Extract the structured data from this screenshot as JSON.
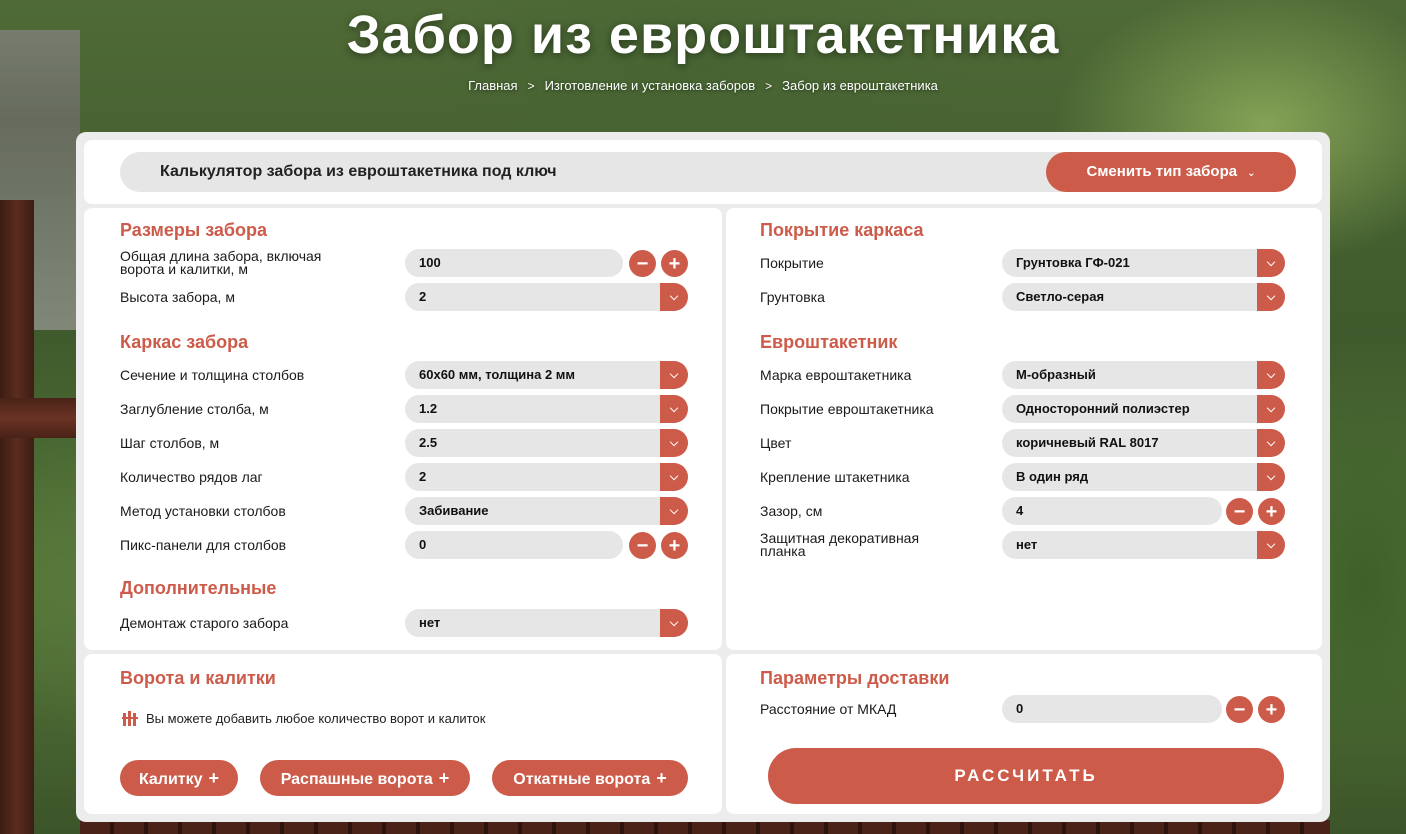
{
  "hero": {
    "title": "Забор из евроштакетника",
    "breadcrumb": [
      "Главная",
      "Изготовление и установка заборов",
      "Забор из евроштакетника"
    ],
    "breadcrumb_sep": ">"
  },
  "calculator": {
    "title": "Калькулятор забора из евроштакетника под ключ",
    "switch_label": "Сменить тип забора",
    "chevron": "⌄"
  },
  "sizes": {
    "title": "Размеры забора",
    "length_label": "Общая длина забора, включая ворота и калитки, м",
    "length_value": "100",
    "height_label": "Высота забора, м",
    "height_value": "2"
  },
  "frame": {
    "title": "Каркас забора",
    "section_label": "Сечение и толщина столбов",
    "section_value": "60x60 мм, толщина 2 мм",
    "depth_label": "Заглубление столба, м",
    "depth_value": "1.2",
    "step_label": "Шаг столбов, м",
    "step_value": "2.5",
    "rows_label": "Количество рядов лаг",
    "rows_value": "2",
    "method_label": "Метод установки столбов",
    "method_value": "Забивание",
    "pix_label": "Пикс-панели для столбов",
    "pix_value": "0"
  },
  "extra": {
    "title": "Дополнительные",
    "dismantle_label": "Демонтаж старого забора",
    "dismantle_value": "нет"
  },
  "coating": {
    "title": "Покрытие каркаса",
    "cover_label": "Покрытие",
    "cover_value": "Грунтовка ГФ-021",
    "primer_label": "Грунтовка",
    "primer_value": "Светло-серая"
  },
  "picket": {
    "title": "Евроштакетник",
    "brand_label": "Марка евроштакетника",
    "brand_value": "М-образный",
    "coat_label": "Покрытие евроштакетника",
    "coat_value": "Односторонний полиэстер",
    "color_label": "Цвет",
    "color_value": "коричневый RAL 8017",
    "mount_label": "Крепление штакетника",
    "mount_value": "В один ряд",
    "gap_label": "Зазор, см",
    "gap_value": "4",
    "strip_label": "Защитная декоративная планка",
    "strip_value": "нет"
  },
  "gates": {
    "title": "Ворота и калитки",
    "info": "Вы можете добавить любое количество ворот и калиток",
    "wicket_label": "Калитку",
    "swing_label": "Распашные ворота",
    "sliding_label": "Откатные ворота",
    "plus": "+"
  },
  "delivery": {
    "title": "Параметры доставки",
    "distance_label": "Расстояние от МКАД",
    "distance_value": "0",
    "calc_label": "РАССЧИТАТЬ"
  },
  "controls": {
    "minus": "−",
    "plus": "+"
  },
  "icons": {
    "select": "chevron-down-icon",
    "minus": "minus-icon",
    "plus": "plus-icon",
    "gates_info": "fence-icon"
  },
  "colors": {
    "accent": "#cd5b4a",
    "field": "#e6e6e6",
    "panel": "#ececec"
  }
}
